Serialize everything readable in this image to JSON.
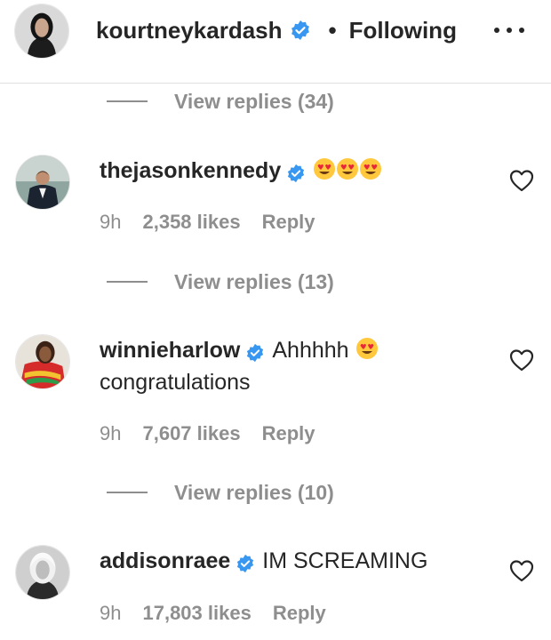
{
  "header": {
    "username": "kourtneykardash",
    "separator": "•",
    "follow_status": "Following"
  },
  "replies_1": {
    "label": "View replies (34)"
  },
  "comments": [
    {
      "username": "thejasonkennedy",
      "text": "",
      "emoji": "😍😍😍",
      "time": "9h",
      "likes": "2,358 likes",
      "reply": "Reply",
      "view_replies": "View replies (13)"
    },
    {
      "username": "winnieharlow",
      "text": "Ahhhhh",
      "emoji": "😍",
      "text_line2": "congratulations",
      "time": "9h",
      "likes": "7,607 likes",
      "reply": "Reply",
      "view_replies": "View replies (10)"
    },
    {
      "username": "addisonraee",
      "text": "IM SCREAMING",
      "time": "9h",
      "likes": "17,803 likes",
      "reply": "Reply"
    }
  ],
  "icons": {
    "verified": "verified-badge-icon",
    "heart": "heart-outline-icon",
    "more": "more-options-icon"
  },
  "colors": {
    "verified_blue": "#3897f0",
    "muted_text": "#8e8e8e",
    "primary_text": "#262626"
  }
}
